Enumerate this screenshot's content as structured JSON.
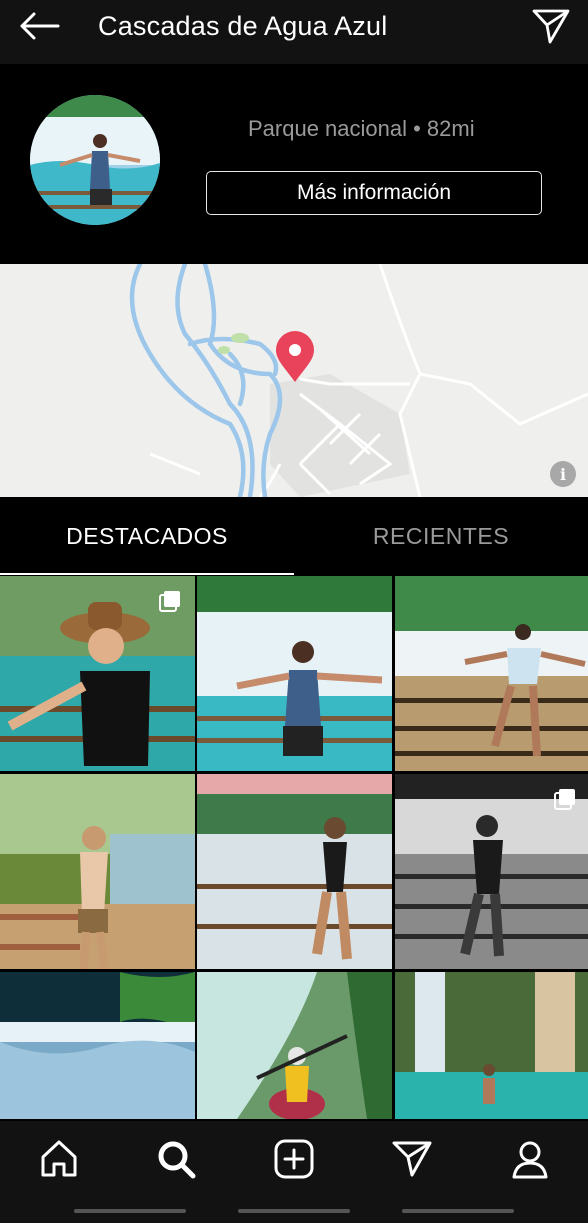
{
  "header": {
    "title": "Cascadas de Agua Azul",
    "back_icon": "arrow-left-icon",
    "share_icon": "paper-plane-icon"
  },
  "location": {
    "meta": "Parque nacional • 82mi",
    "more_info_label": "Más información"
  },
  "map": {
    "pin_color": "#e8435a",
    "river_color": "#9cc6ea",
    "road_color": "#ffffff"
  },
  "tabs": [
    {
      "label": "DESTACADOS",
      "active": true
    },
    {
      "label": "RECIENTES",
      "active": false
    }
  ],
  "grid": {
    "items": [
      {
        "name": "photo-woman-hat-railing",
        "multiple": true
      },
      {
        "name": "photo-man-waterfall-blue-tank",
        "multiple": false
      },
      {
        "name": "photo-man-sitting-rail",
        "multiple": false
      },
      {
        "name": "photo-woman-jungle-view",
        "multiple": false
      },
      {
        "name": "photo-woman-bikini-falls",
        "multiple": false
      },
      {
        "name": "photo-woman-bw-falls",
        "multiple": true
      },
      {
        "name": "photo-waterfall-wide",
        "multiple": false
      },
      {
        "name": "photo-kayak-falls",
        "multiple": false
      },
      {
        "name": "photo-person-turquoise-pool",
        "multiple": false
      }
    ]
  },
  "bottom_nav": [
    {
      "name": "home-icon"
    },
    {
      "name": "search-icon"
    },
    {
      "name": "add-post-icon"
    },
    {
      "name": "paper-plane-icon"
    },
    {
      "name": "profile-icon"
    }
  ],
  "colors": {
    "bar_bg": "#121212",
    "page_bg": "#000000",
    "muted_text": "#9a9a9a"
  }
}
